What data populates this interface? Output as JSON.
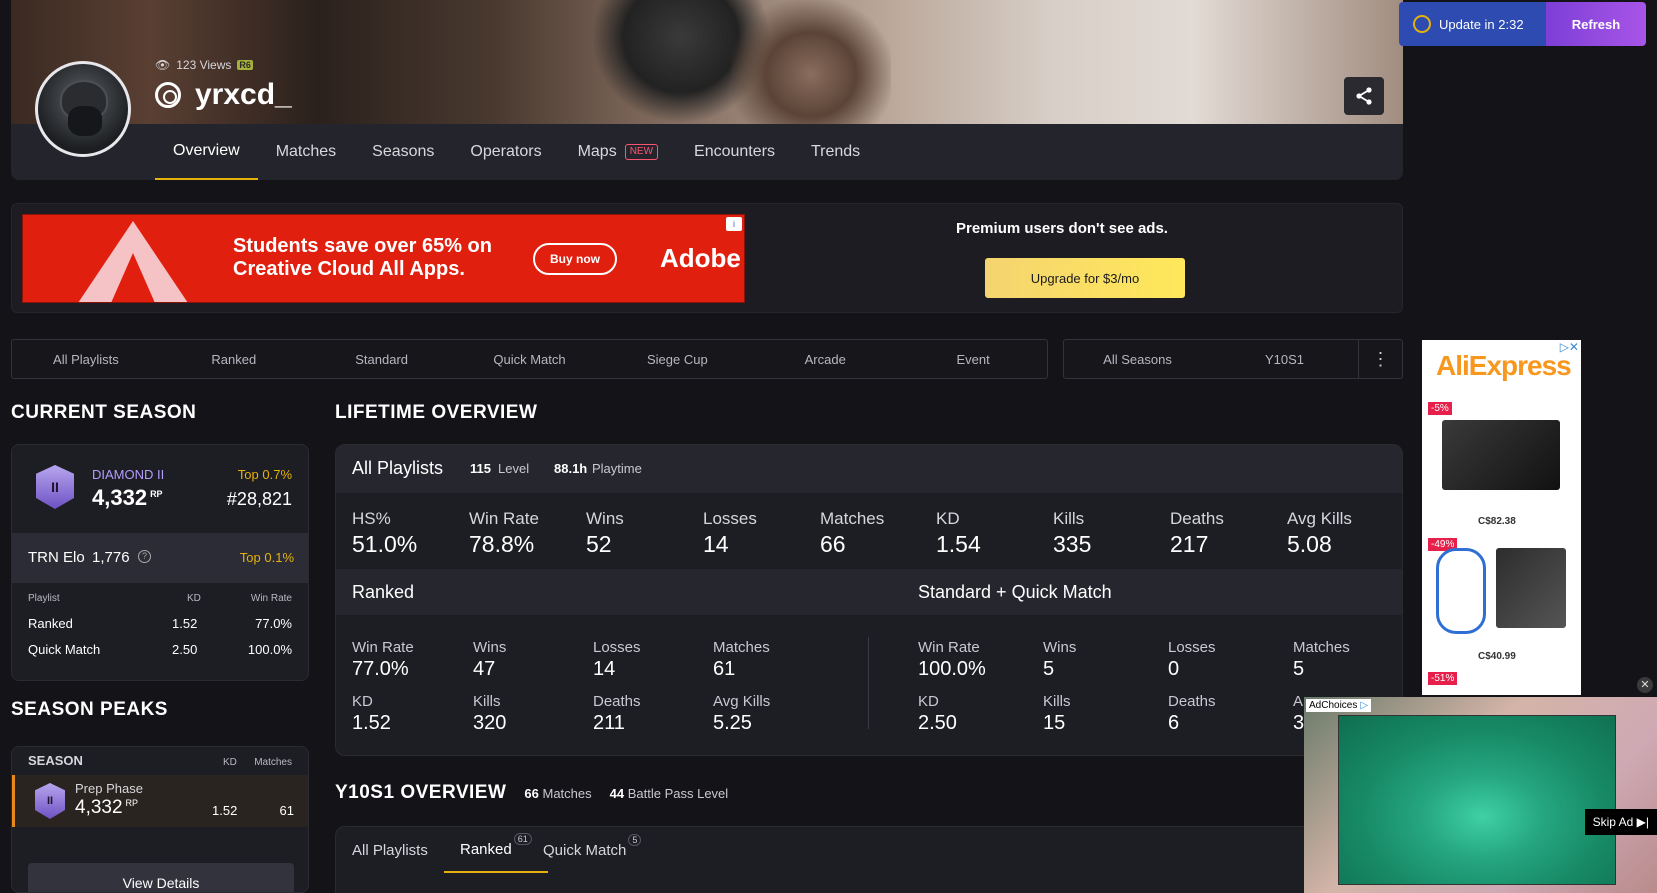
{
  "profile": {
    "views": "123 Views",
    "game_badge": "R6",
    "username": "yrxcd_"
  },
  "nav": {
    "tabs": [
      {
        "label": "Overview"
      },
      {
        "label": "Matches"
      },
      {
        "label": "Seasons"
      },
      {
        "label": "Operators"
      },
      {
        "label": "Maps",
        "badge": "NEW"
      },
      {
        "label": "Encounters"
      },
      {
        "label": "Trends"
      }
    ]
  },
  "update": {
    "label": "Update in 2:32",
    "refresh": "Refresh"
  },
  "ads": {
    "adobe_headline": "Students save over 65% on Creative Cloud All Apps.",
    "adobe_button": "Buy now",
    "adobe_brand": "Adobe",
    "premium_text": "Premium users don't see ads.",
    "upgrade_label": "Upgrade for $3/mo",
    "ali_brand_a": "Ali",
    "ali_brand_b": "Express",
    "ali_items": [
      {
        "discount": "-5%",
        "price": "C$82.38"
      },
      {
        "discount": "-49%",
        "price": "C$40.99"
      },
      {
        "discount": "-51%",
        "price": ""
      }
    ],
    "video_choices": "AdChoices",
    "video_skip": "Skip Ad ▶|"
  },
  "filters": {
    "playlists": [
      "All Playlists",
      "Ranked",
      "Standard",
      "Quick Match",
      "Siege Cup",
      "Arcade",
      "Event"
    ],
    "seasons": [
      "All Seasons",
      "Y10S1"
    ]
  },
  "current_season": {
    "title": "CURRENT SEASON",
    "rank_name": "DIAMOND II",
    "rp": "4,332",
    "rp_unit": "RP",
    "top_pct": "Top 0.7%",
    "position": "#28,821",
    "trn_label": "TRN Elo",
    "trn_value": "1,776",
    "trn_top": "Top 0.1%",
    "table_headers": [
      "Playlist",
      "KD",
      "Win Rate"
    ],
    "rows": [
      {
        "playlist": "Ranked",
        "kd": "1.52",
        "win_rate": "77.0%"
      },
      {
        "playlist": "Quick Match",
        "kd": "2.50",
        "win_rate": "100.0%"
      }
    ]
  },
  "season_peaks": {
    "title": "SEASON PEAKS",
    "headers": [
      "SEASON",
      "KD",
      "Matches"
    ],
    "row": {
      "season": "Prep Phase",
      "rp": "4,332",
      "rp_unit": "RP",
      "kd": "1.52",
      "matches": "61"
    },
    "view_details": "View Details"
  },
  "lifetime": {
    "title": "LIFETIME OVERVIEW",
    "head_label": "All Playlists",
    "level_value": "115",
    "level_label": "Level",
    "playtime_value": "88.1h",
    "playtime_label": "Playtime",
    "stats": [
      {
        "label": "HS%",
        "value": "51.0%"
      },
      {
        "label": "Win Rate",
        "value": "78.8%"
      },
      {
        "label": "Wins",
        "value": "52"
      },
      {
        "label": "Losses",
        "value": "14"
      },
      {
        "label": "Matches",
        "value": "66"
      },
      {
        "label": "KD",
        "value": "1.54"
      },
      {
        "label": "Kills",
        "value": "335"
      },
      {
        "label": "Deaths",
        "value": "217"
      },
      {
        "label": "Avg Kills",
        "value": "5.08"
      }
    ],
    "ranked_title": "Ranked",
    "ranked": [
      {
        "label": "Win Rate",
        "value": "77.0%"
      },
      {
        "label": "Wins",
        "value": "47"
      },
      {
        "label": "Losses",
        "value": "14"
      },
      {
        "label": "Matches",
        "value": "61"
      },
      {
        "label": "KD",
        "value": "1.52"
      },
      {
        "label": "Kills",
        "value": "320"
      },
      {
        "label": "Deaths",
        "value": "211"
      },
      {
        "label": "Avg Kills",
        "value": "5.25"
      }
    ],
    "sq_title": "Standard + Quick Match",
    "sq": [
      {
        "label": "Win Rate",
        "value": "100.0%"
      },
      {
        "label": "Wins",
        "value": "5"
      },
      {
        "label": "Losses",
        "value": "0"
      },
      {
        "label": "Matches",
        "value": "5"
      },
      {
        "label": "KD",
        "value": "2.50"
      },
      {
        "label": "Kills",
        "value": "15"
      },
      {
        "label": "Deaths",
        "value": "6"
      },
      {
        "label": "A",
        "value": "3"
      }
    ]
  },
  "season_overview": {
    "title": "Y10S1 OVERVIEW",
    "matches_value": "66",
    "matches_label": "Matches",
    "bp_value": "44",
    "bp_label": "Battle Pass Level",
    "tabs": [
      {
        "label": "All Playlists",
        "count": ""
      },
      {
        "label": "Ranked",
        "count": "61"
      },
      {
        "label": "Quick Match",
        "count": "5"
      }
    ]
  },
  "colors": {
    "accent": "#e5b20b",
    "diamond": "#b49cff",
    "gold": "#e5b20b"
  }
}
